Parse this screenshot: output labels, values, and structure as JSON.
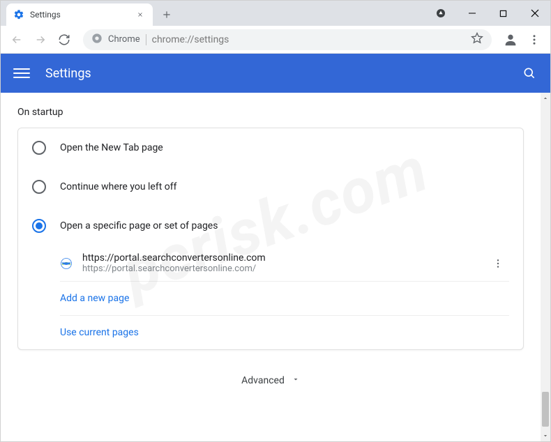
{
  "tab": {
    "title": "Settings"
  },
  "omnibox": {
    "label": "Chrome",
    "url": "chrome://settings"
  },
  "header": {
    "title": "Settings"
  },
  "section": {
    "title": "On startup"
  },
  "radios": {
    "new_tab": "Open the New Tab page",
    "continue": "Continue where you left off",
    "specific": "Open a specific page or set of pages"
  },
  "page_entry": {
    "title": "https://portal.searchconvertersonline.com",
    "url": "https://portal.searchconvertersonline.com/"
  },
  "links": {
    "add": "Add a new page",
    "use_current": "Use current pages"
  },
  "footer": {
    "advanced": "Advanced"
  },
  "watermark": "pcrisk.com"
}
